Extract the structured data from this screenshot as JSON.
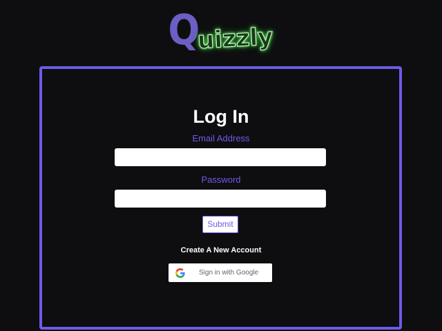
{
  "logo": {
    "first_letter": "Q",
    "rest": "uizzly"
  },
  "login": {
    "title": "Log In",
    "email_label": "Email Address",
    "email_value": "",
    "password_label": "Password",
    "password_value": "",
    "submit_label": "Submit",
    "create_account_label": "Create A New Account",
    "google_button_label": "Sign in with Google"
  },
  "colors": {
    "background": "#0e0e10",
    "accent": "#6c5ce7",
    "logo_glow": "#7dff7d"
  },
  "icons": {
    "google": "google-g-icon"
  }
}
